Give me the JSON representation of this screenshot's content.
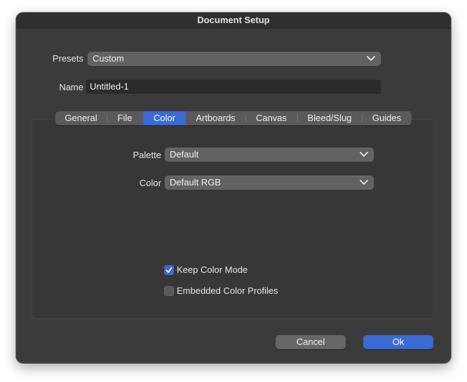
{
  "window": {
    "title": "Document Setup"
  },
  "presets": {
    "label": "Presets",
    "value": "Custom"
  },
  "name": {
    "label": "Name",
    "value": "Untitled-1"
  },
  "tabs": [
    {
      "label": "General"
    },
    {
      "label": "File"
    },
    {
      "label": "Color"
    },
    {
      "label": "Artboards"
    },
    {
      "label": "Canvas"
    },
    {
      "label": "Bleed/Slug"
    },
    {
      "label": "Guides"
    }
  ],
  "active_tab": "Color",
  "palette": {
    "label": "Palette",
    "value": "Default"
  },
  "color": {
    "label": "Color",
    "value": "Default RGB"
  },
  "options": {
    "keep_color_mode": {
      "label": "Keep Color Mode",
      "checked": true
    },
    "embedded_profiles": {
      "label": "Embedded Color Profiles",
      "checked": false
    }
  },
  "buttons": {
    "cancel": "Cancel",
    "ok": "Ok"
  },
  "colors": {
    "accent": "#3a6ad4",
    "window_bg": "#3b3b3b"
  }
}
